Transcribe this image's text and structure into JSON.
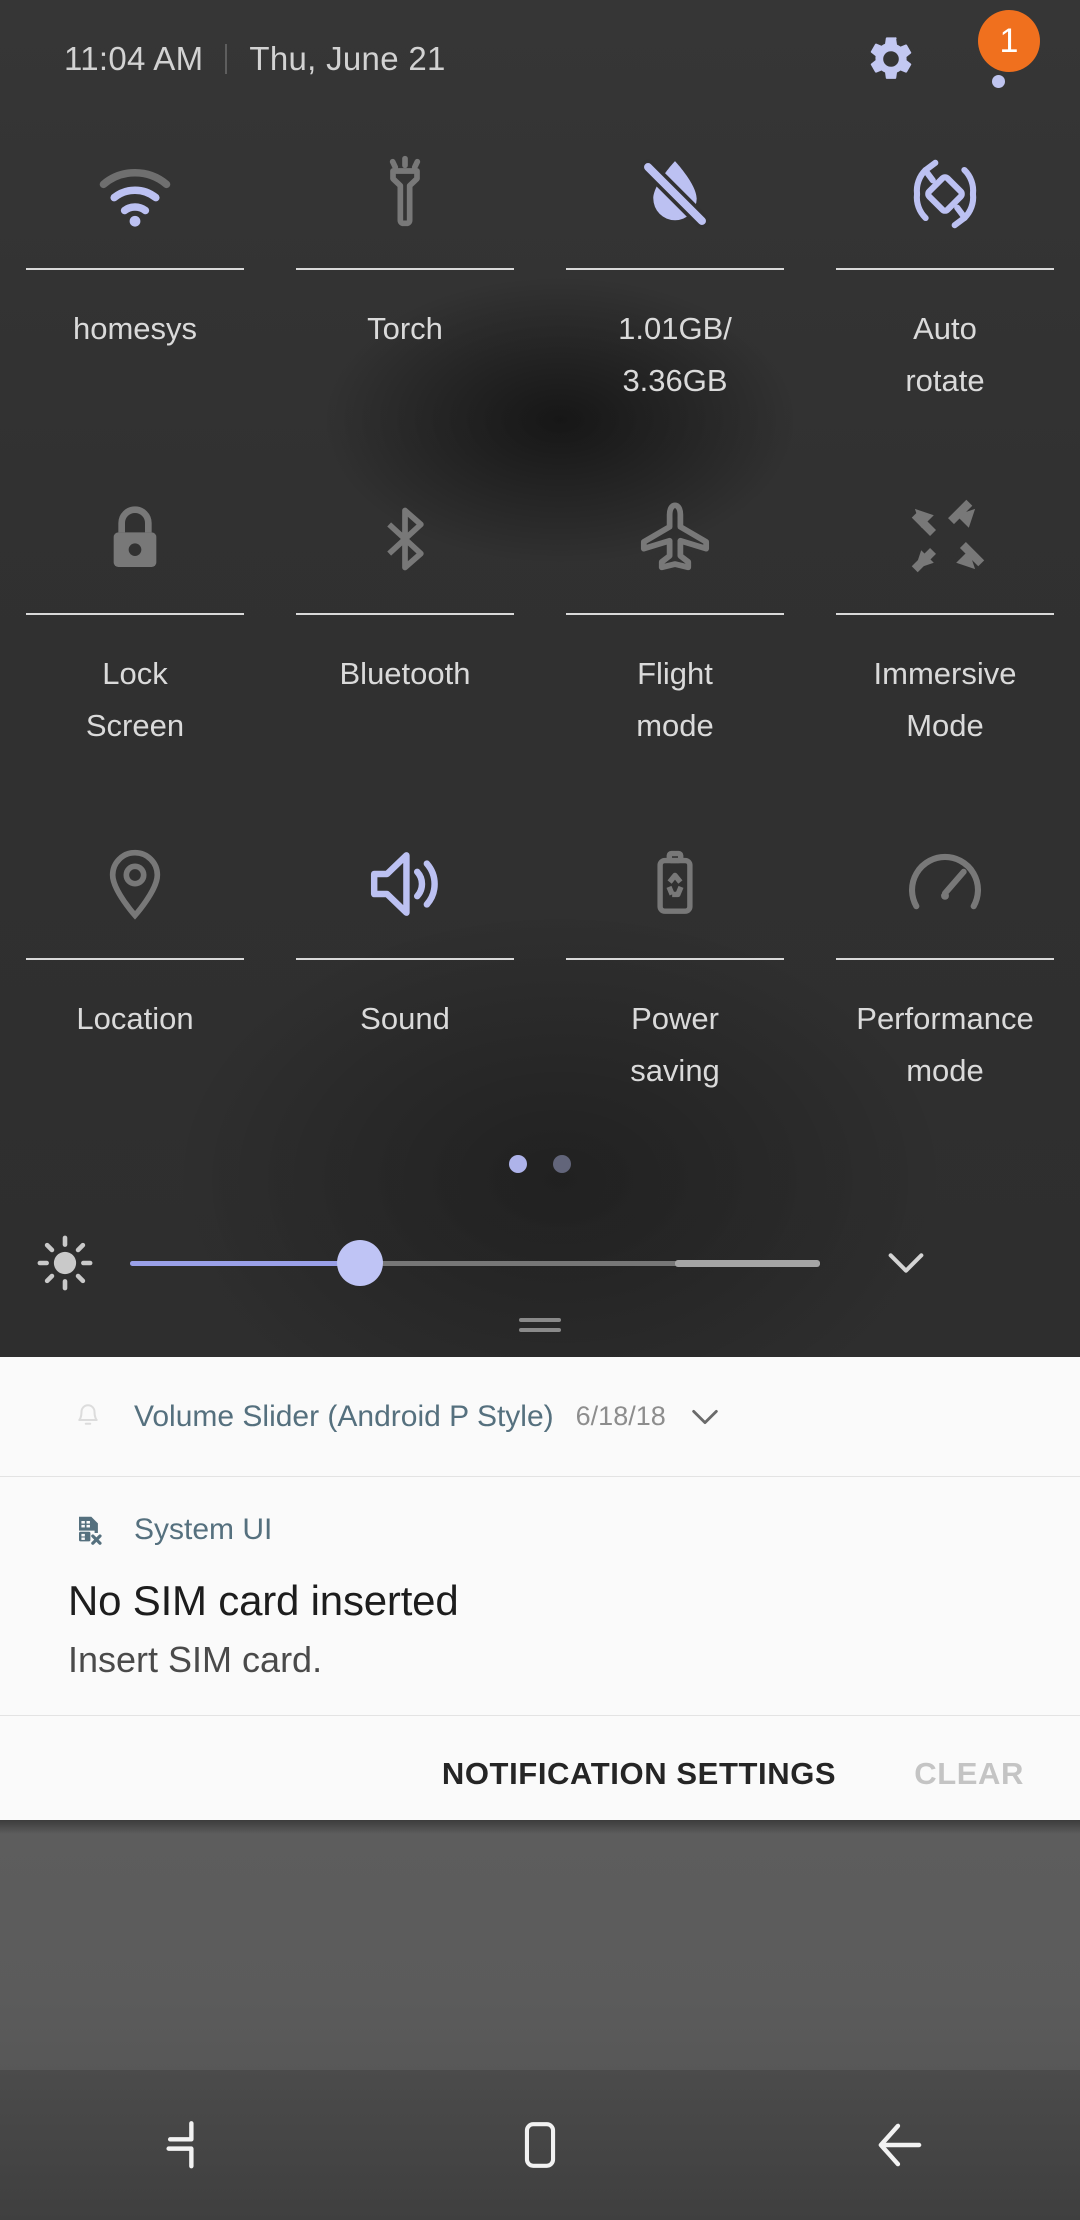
{
  "status_bar": {
    "time": "11:04 AM",
    "date": "Thu, June 21",
    "settings_icon": "gear-icon",
    "overflow_icon": "overflow-menu-icon",
    "badge_count": "1",
    "badge_color": "#f0701e"
  },
  "quick_settings": {
    "accent_color": "#aeb3ea",
    "inactive_color": "#787878",
    "rows": [
      [
        {
          "label": "homesys",
          "icon": "wifi-icon",
          "active": true
        },
        {
          "label": "Torch",
          "icon": "flashlight-icon",
          "active": false
        },
        {
          "label": "1.01GB/\n3.36GB",
          "icon": "water-drop-slash-icon",
          "active": true
        },
        {
          "label": "Auto\nrotate",
          "icon": "auto-rotate-icon",
          "active": true
        }
      ],
      [
        {
          "label": "Lock\nScreen",
          "icon": "lock-icon",
          "active": false
        },
        {
          "label": "Bluetooth",
          "icon": "bluetooth-icon",
          "active": false
        },
        {
          "label": "Flight\nmode",
          "icon": "airplane-icon",
          "active": false
        },
        {
          "label": "Immersive\nMode",
          "icon": "collapse-arrows-icon",
          "active": false
        }
      ],
      [
        {
          "label": "Location",
          "icon": "location-pin-icon",
          "active": false
        },
        {
          "label": "Sound",
          "icon": "speaker-icon",
          "active": true
        },
        {
          "label": "Power\nsaving",
          "icon": "battery-saver-icon",
          "active": false
        },
        {
          "label": "Performance\nmode",
          "icon": "speedometer-icon",
          "active": false
        }
      ]
    ],
    "pages": {
      "count": 2,
      "current": 1
    },
    "brightness": {
      "icon": "brightness-icon",
      "value_percent": 33,
      "expand_icon": "chevron-down-icon"
    },
    "drag_handle": "panel-drag-handle"
  },
  "notifications": [
    {
      "icon": "bell-icon",
      "app": "Volume Slider (Android P Style)",
      "date": "6/18/18",
      "expand_icon": "chevron-down-icon",
      "type": "compact"
    },
    {
      "icon": "sim-card-error-icon",
      "app": "System UI",
      "title": "No SIM card inserted",
      "body": "Insert SIM card.",
      "type": "expanded"
    }
  ],
  "shade_actions": {
    "settings_label": "NOTIFICATION SETTINGS",
    "clear_label": "CLEAR"
  },
  "navbar": {
    "recents_icon": "recents-icon",
    "home_icon": "home-icon",
    "back_icon": "back-icon"
  }
}
